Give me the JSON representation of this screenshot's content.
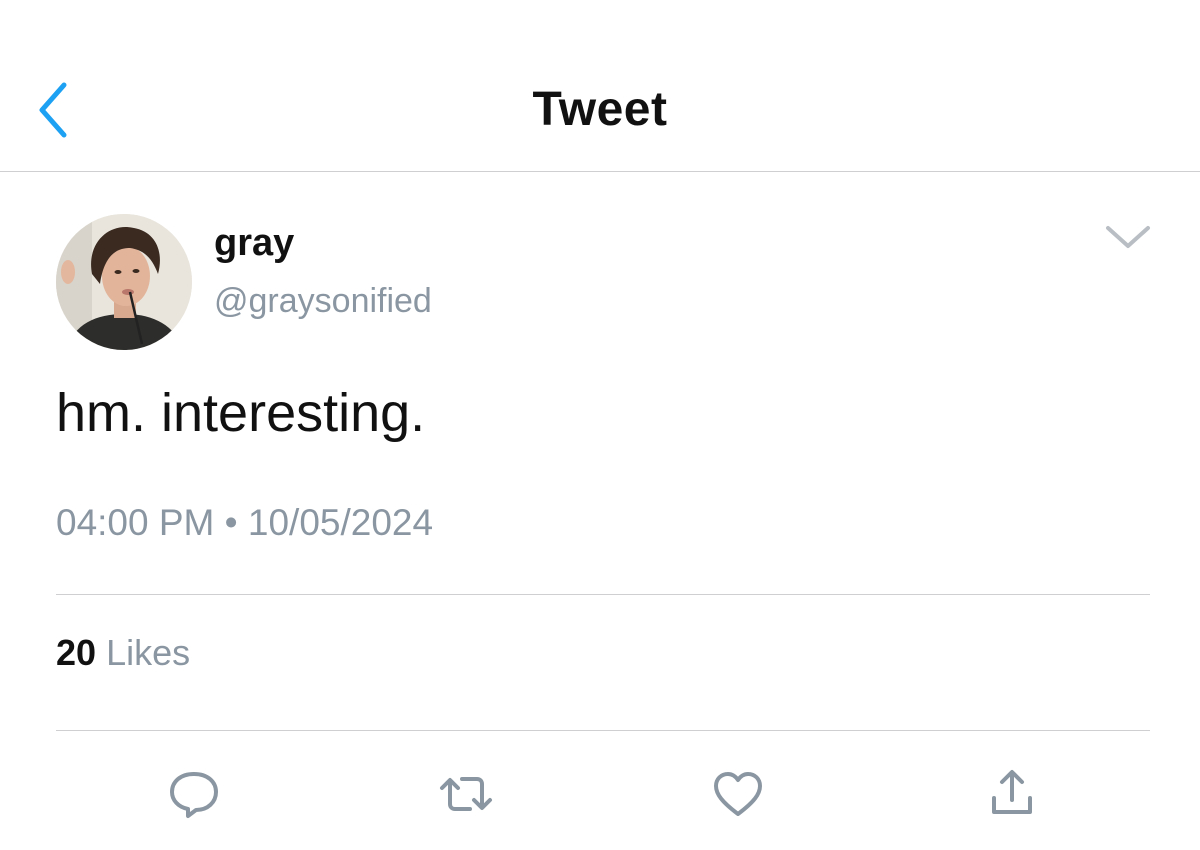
{
  "header": {
    "title": "Tweet",
    "back_icon": "chevron-left-icon",
    "accent_color": "#1da1f2"
  },
  "tweet": {
    "author": {
      "name": "gray",
      "handle": "@graysonified",
      "avatar_icon": "profile-photo"
    },
    "text": "hm. interesting.",
    "timestamp": "04:00 PM • 10/05/2024",
    "likes": {
      "count": "20",
      "label": "Likes"
    },
    "menu_icon": "chevron-down-icon"
  },
  "actions": [
    {
      "name": "reply",
      "icon": "reply-icon"
    },
    {
      "name": "retweet",
      "icon": "retweet-icon"
    },
    {
      "name": "like",
      "icon": "heart-icon"
    },
    {
      "name": "share",
      "icon": "share-icon"
    }
  ],
  "colors": {
    "text_primary": "#111111",
    "text_secondary": "#8a96a1",
    "divider": "#cfcfd1",
    "icon_gray": "#8a96a1"
  }
}
